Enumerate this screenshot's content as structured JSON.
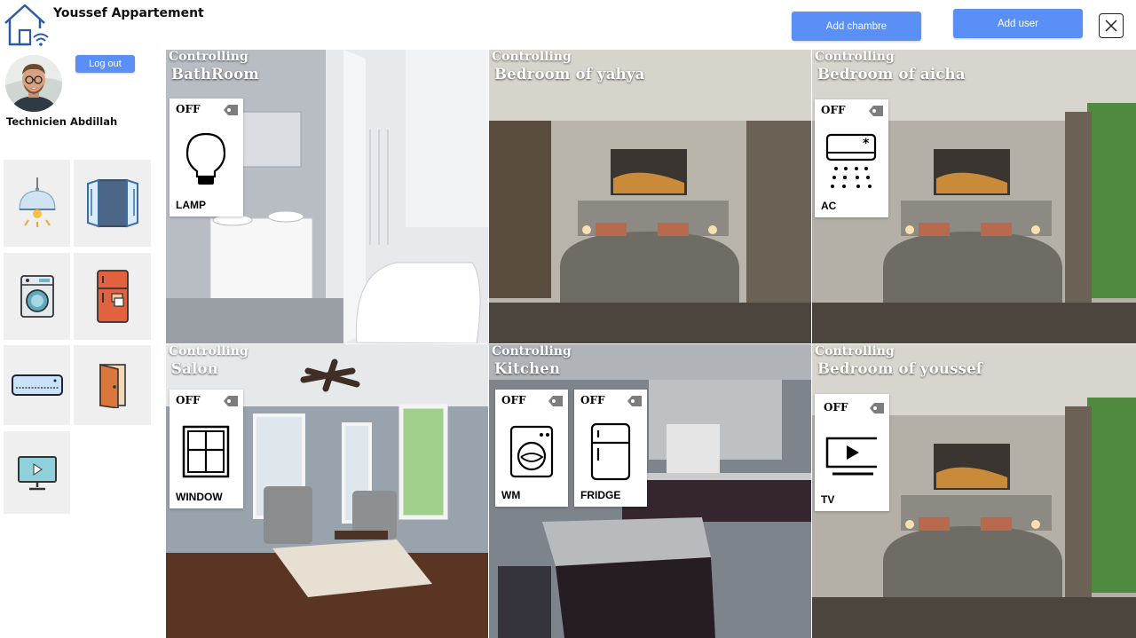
{
  "header": {
    "app_title": "Youssef Appartement",
    "add_chambre_label": "Add chambre",
    "add_user_label": "Add user"
  },
  "profile": {
    "logout_label": "Log out",
    "name": "Technicien Abdillah"
  },
  "palette": [
    {
      "icon": "lamp-icon"
    },
    {
      "icon": "window-icon"
    },
    {
      "icon": "washing-machine-icon"
    },
    {
      "icon": "fridge-icon"
    },
    {
      "icon": "air-conditioner-icon"
    },
    {
      "icon": "door-icon"
    },
    {
      "icon": "tv-icon"
    }
  ],
  "rooms": [
    {
      "controlling": "Controlling",
      "name": "BathRoom",
      "devices": [
        {
          "state": "OFF",
          "label": "LAMP",
          "icon": "lamp-icon"
        }
      ]
    },
    {
      "controlling": "Controlling",
      "name": "Bedroom of yahya",
      "devices": []
    },
    {
      "controlling": "Controlling",
      "name": "Bedroom of aicha",
      "devices": [
        {
          "state": "OFF",
          "label": "AC",
          "icon": "air-conditioner-icon"
        }
      ]
    },
    {
      "controlling": "Controlling",
      "name": "Salon",
      "devices": [
        {
          "state": "OFF",
          "label": "WINDOW",
          "icon": "window-icon"
        }
      ]
    },
    {
      "controlling": "Controlling",
      "name": "Kitchen",
      "devices": [
        {
          "state": "OFF",
          "label": "WM",
          "icon": "washing-machine-icon"
        },
        {
          "state": "OFF",
          "label": "FRIDGE",
          "icon": "fridge-icon"
        }
      ]
    },
    {
      "controlling": "Controlling",
      "name": "Bedroom of youssef",
      "devices": [
        {
          "state": "OFF",
          "label": "TV",
          "icon": "tv-icon"
        }
      ]
    }
  ],
  "colors": {
    "accent": "#5a8ff5",
    "tile_bg": "#efefef"
  }
}
